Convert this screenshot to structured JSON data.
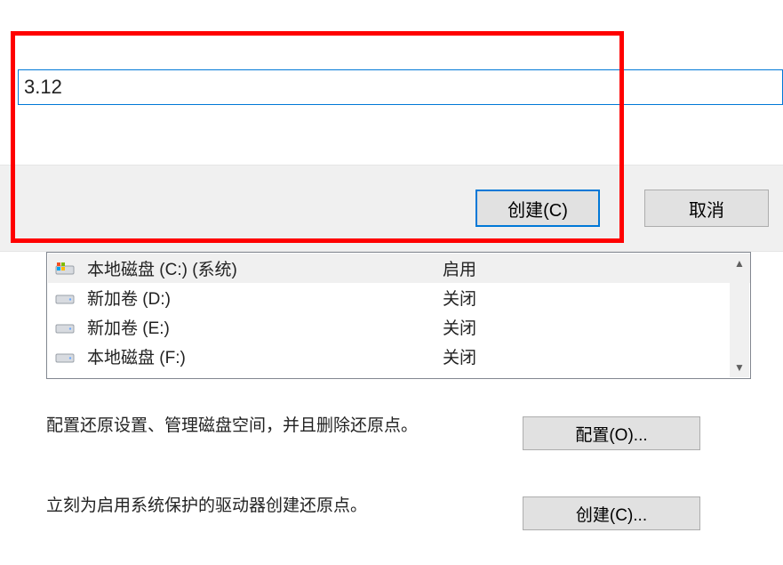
{
  "dialog": {
    "input_value": "3.12",
    "create_label": "创建(C)",
    "cancel_label": "取消"
  },
  "panel": {
    "drives": [
      {
        "name": "本地磁盘 (C:) (系统)",
        "status": "启用",
        "selected": true,
        "icon": "windows"
      },
      {
        "name": "新加卷 (D:)",
        "status": "关闭",
        "selected": false,
        "icon": "disk"
      },
      {
        "name": "新加卷 (E:)",
        "status": "关闭",
        "selected": false,
        "icon": "disk"
      },
      {
        "name": "本地磁盘 (F:)",
        "status": "关闭",
        "selected": false,
        "icon": "disk"
      }
    ],
    "desc_configure": "配置还原设置、管理磁盘空间，并且删除还原点。",
    "btn_configure": "配置(O)...",
    "desc_create": "立刻为启用系统保护的驱动器创建还原点。",
    "btn_create": "创建(C)..."
  }
}
